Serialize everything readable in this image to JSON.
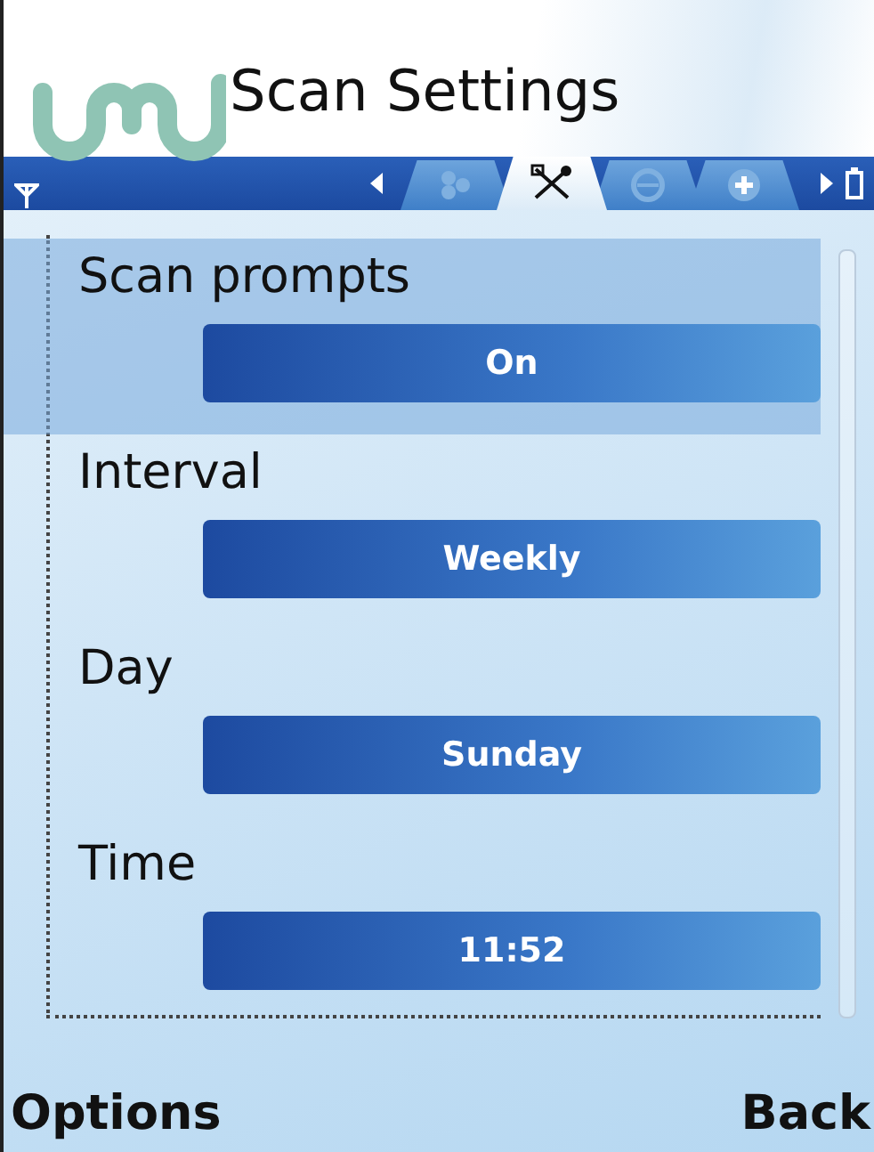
{
  "title": "Scan Settings",
  "tabs": [
    {
      "kind": "group",
      "selected": false
    },
    {
      "kind": "tools",
      "selected": true
    },
    {
      "kind": "globe",
      "selected": false
    },
    {
      "kind": "plus",
      "selected": false
    }
  ],
  "settings": [
    {
      "label": "Scan prompts",
      "value": "On",
      "selected": true
    },
    {
      "label": "Interval",
      "value": "Weekly",
      "selected": false
    },
    {
      "label": "Day",
      "value": "Sunday",
      "selected": false
    },
    {
      "label": "Time",
      "value": "11:52",
      "selected": false
    }
  ],
  "softkeys": {
    "left": "Options",
    "right": "Back"
  }
}
